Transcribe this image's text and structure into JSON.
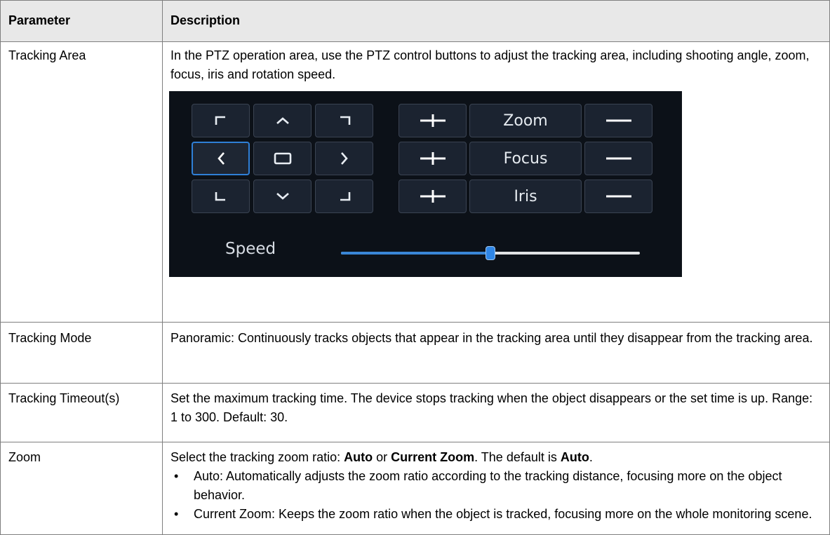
{
  "table": {
    "header": {
      "parameter": "Parameter",
      "description": "Description"
    },
    "rows": [
      {
        "parameter": "Tracking Area",
        "description": "In the PTZ operation area, use the PTZ control buttons to adjust the tracking area, including shooting angle, zoom, focus, iris and rotation speed."
      },
      {
        "parameter": "Tracking Mode",
        "description": "Panoramic: Continuously tracks objects that appear in the tracking area until they disappear from the tracking area."
      },
      {
        "parameter": "Tracking Timeout(s)",
        "description": "Set the maximum tracking time. The device stops tracking when the object disappears or the set time is up. Range: 1 to 300. Default: 30."
      },
      {
        "parameter": "Zoom",
        "description_prefix": "Select the tracking zoom ratio: ",
        "opt_auto": "Auto",
        "or_text": " or ",
        "opt_current": "Current Zoom",
        "default_text": ". The default is ",
        "default_value": "Auto",
        "end_text": ".",
        "bullets": [
          "Auto: Automatically adjusts the zoom ratio according to the tracking distance, focusing more on the object behavior.",
          "Current Zoom: Keeps the zoom ratio when the object is tracked, focusing more on the whole monitoring scene."
        ]
      }
    ]
  },
  "ptz": {
    "direction_icons": [
      "up-left-icon",
      "up-icon",
      "up-right-icon",
      "left-icon",
      "stop-icon",
      "right-icon",
      "down-left-icon",
      "down-icon",
      "down-right-icon"
    ],
    "selected": "left-icon",
    "lens_labels": [
      "Zoom",
      "Focus",
      "Iris"
    ],
    "plus_icon": "plus-icon",
    "minus_icon": "minus-icon",
    "speed_label": "Speed",
    "speed_fraction": 0.5,
    "colors": {
      "panel": "#0c1118",
      "accent": "#2f86e6",
      "button": "#1b2330"
    }
  }
}
